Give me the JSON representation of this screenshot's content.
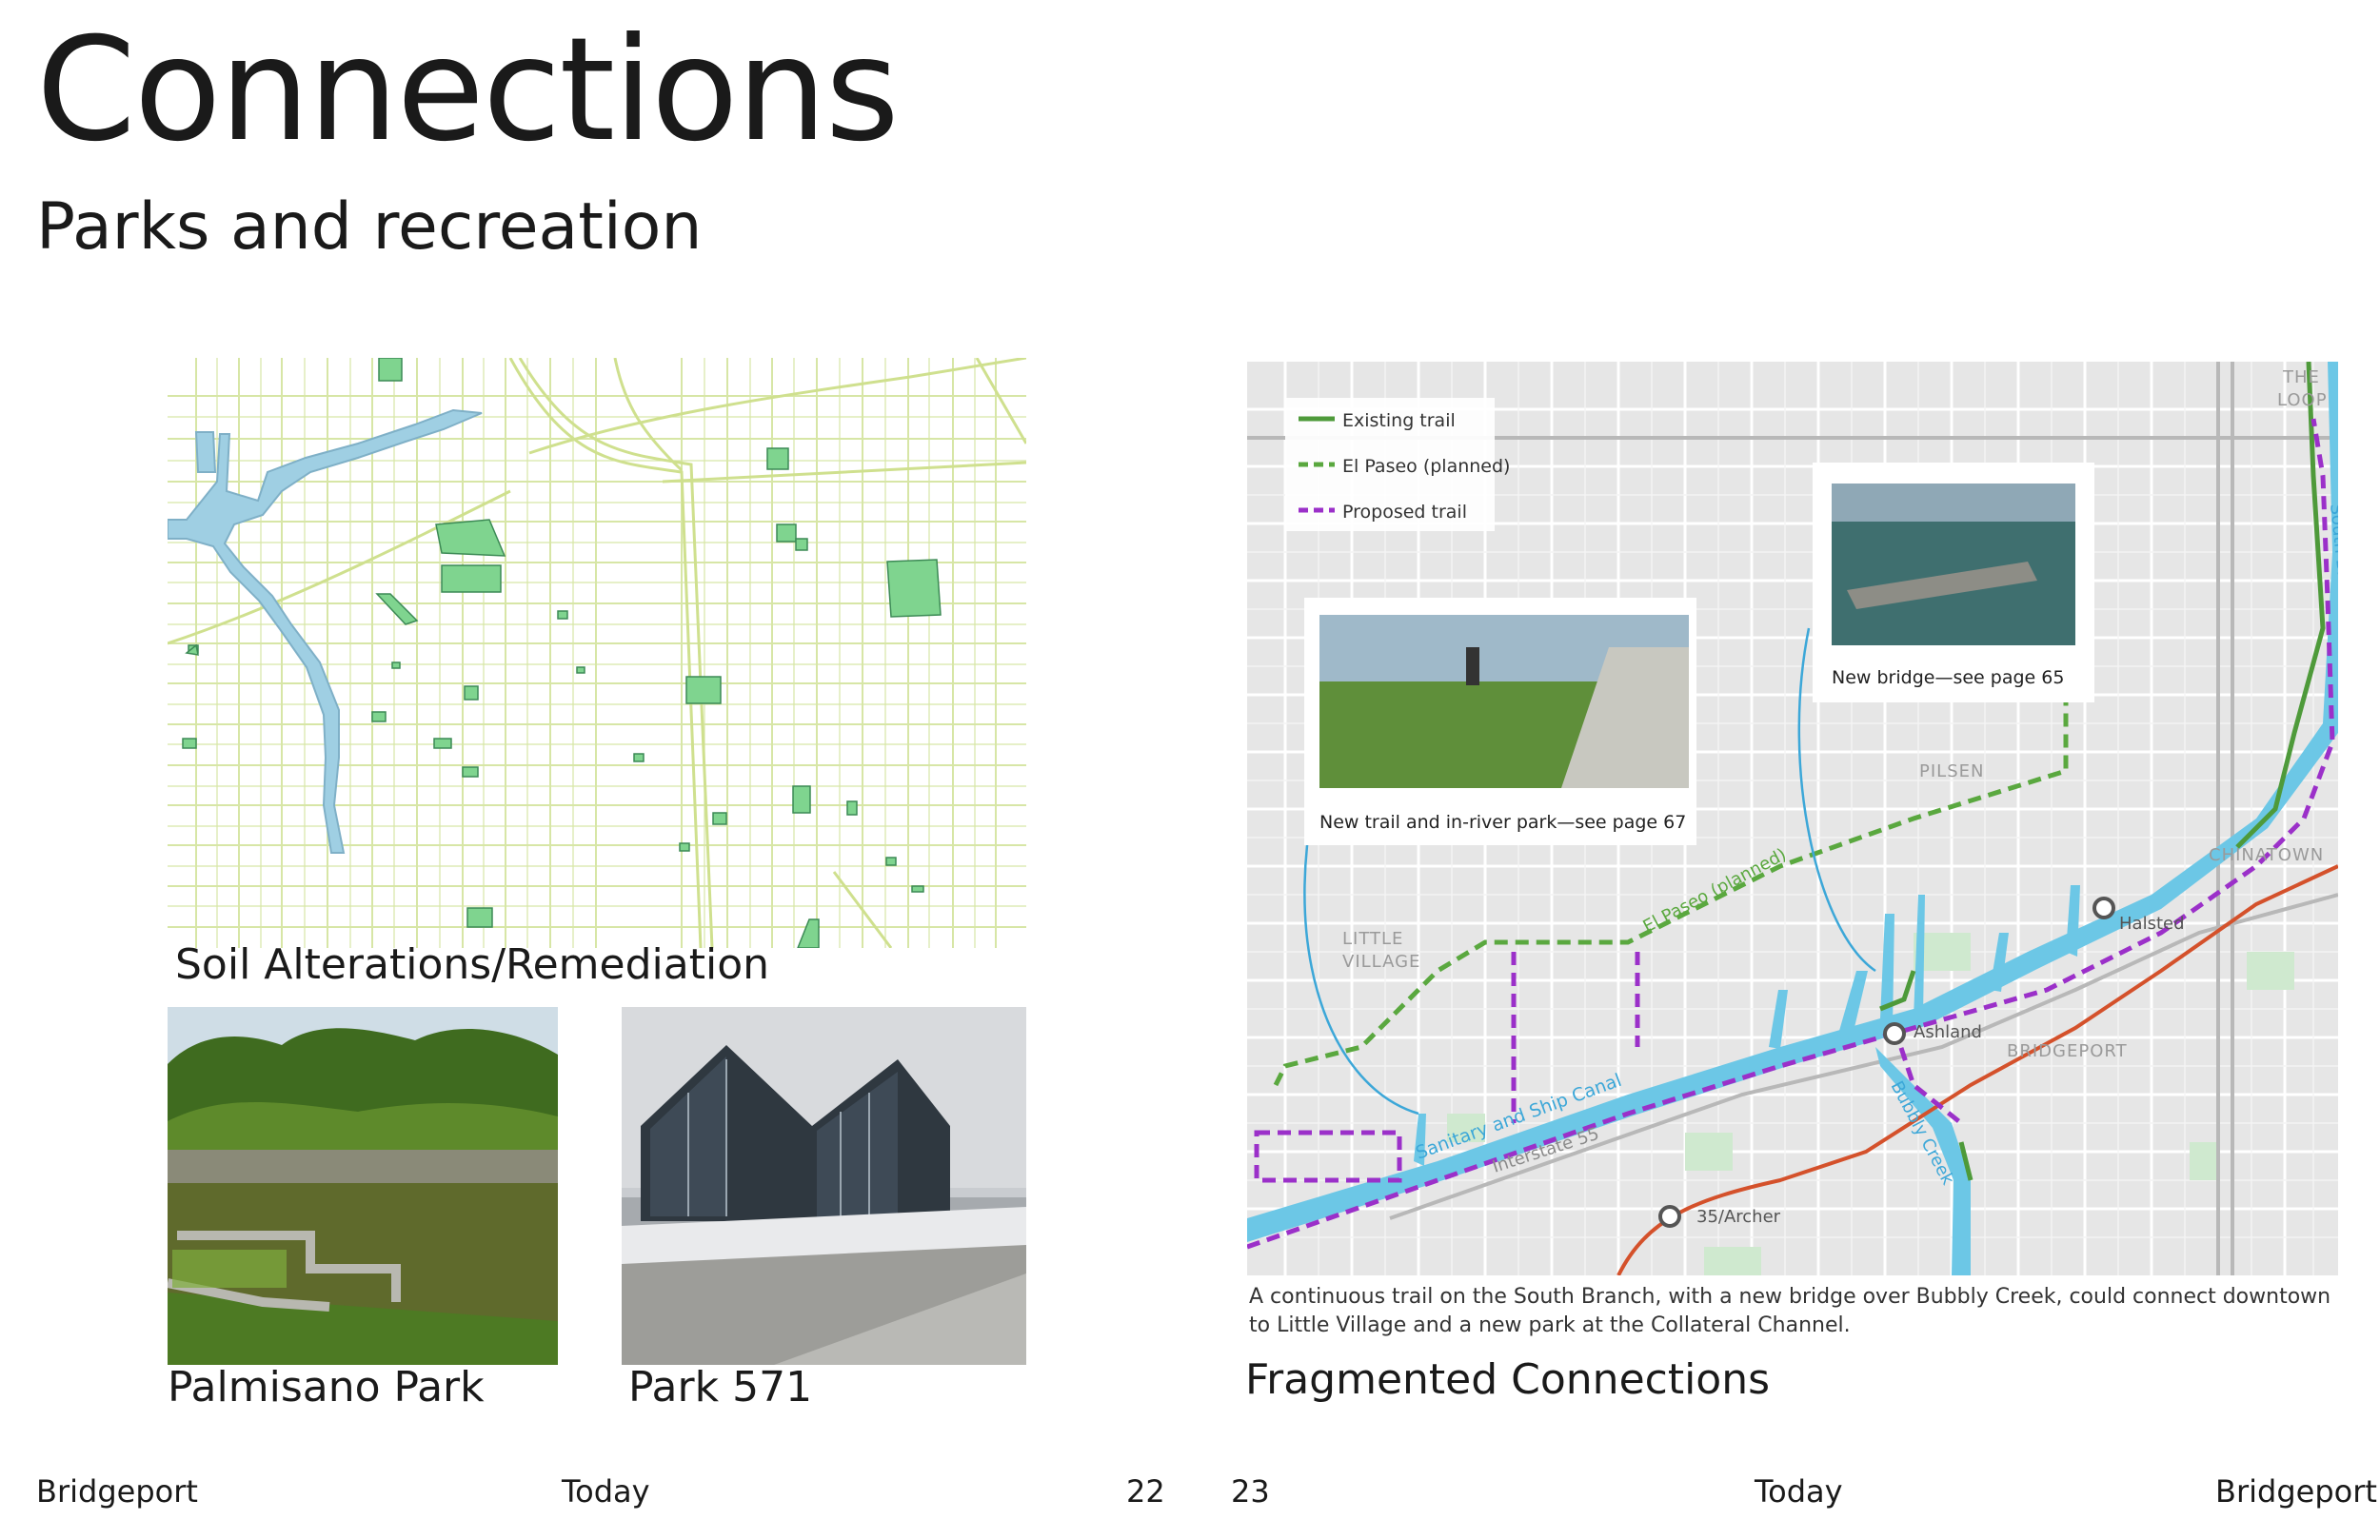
{
  "header": {
    "title": "Connections",
    "subtitle": "Parks and recreation"
  },
  "left_page": {
    "soil_map_caption": "Soil Alterations/Remediation",
    "photo1_caption": "Palmisano Park",
    "photo2_caption": "Park 571"
  },
  "right_page": {
    "legend": {
      "existing": "Existing trail",
      "el_paseo": "El Paseo (planned)",
      "proposed": "Proposed trail"
    },
    "callout_left": "New trail and in-river park—see page 67",
    "callout_right": "New bridge—see page 65",
    "labels": {
      "the_loop_1": "THE",
      "the_loop_2": "LOOP",
      "south_branch": "South Branch Chicago River",
      "pilsen": "PILSEN",
      "chinatown": "CHINATOWN",
      "little_village_1": "LITTLE",
      "little_village_2": "VILLAGE",
      "el_paseo": "El Paseo (planned)",
      "halsted": "Halsted",
      "ashland": "Ashland",
      "bridgeport": "BRIDGEPORT",
      "sanitary": "Sanitary and Ship Canal",
      "interstate": "Interstate 55",
      "bubbly": "Bubbly Creek",
      "archer": "35/Archer"
    },
    "map_caption": "A continuous trail on the South Branch, with a new bridge over Bubbly Creek, could connect downtown to Little Village and a new park at the Collateral Channel.",
    "section_caption": "Fragmented Connections"
  },
  "colors": {
    "existing_trail": "#4e9a3a",
    "el_paseo": "#5aa83f",
    "proposed_trail": "#9b30c9",
    "water": "#6cc7e6",
    "rail": "#d4512b",
    "park_green": "#7fd48f"
  },
  "footer": {
    "left_name": "Bridgeport",
    "left_center": "Today",
    "left_page_no": "22",
    "right_page_no": "23",
    "right_center": "Today",
    "right_name": "Bridgeport"
  }
}
